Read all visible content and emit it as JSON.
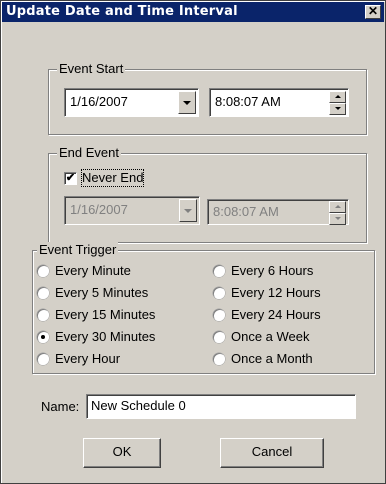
{
  "window": {
    "title": "Update Date and Time Interval",
    "close_glyph": "✕"
  },
  "event_start": {
    "label": "Event Start",
    "date": "1/16/2007",
    "time": "8:08:07 AM"
  },
  "end_event": {
    "label": "End Event",
    "never_end_label": "Never End",
    "never_end_checked": true,
    "date": "1/16/2007",
    "time": "8:08:07 AM"
  },
  "event_trigger": {
    "label": "Event Trigger",
    "options": [
      {
        "label": "Every Minute",
        "selected": false
      },
      {
        "label": "Every 5 Minutes",
        "selected": false
      },
      {
        "label": "Every 15 Minutes",
        "selected": false
      },
      {
        "label": "Every 30 Minutes",
        "selected": true
      },
      {
        "label": "Every Hour",
        "selected": false
      },
      {
        "label": "Every 6 Hours",
        "selected": false
      },
      {
        "label": "Every 12 Hours",
        "selected": false
      },
      {
        "label": "Every 24 Hours",
        "selected": false
      },
      {
        "label": "Once a Week",
        "selected": false
      },
      {
        "label": "Once a Month",
        "selected": false
      }
    ]
  },
  "name": {
    "label": "Name:",
    "value": "New Schedule 0"
  },
  "buttons": {
    "ok": "OK",
    "cancel": "Cancel"
  },
  "colors": {
    "titlebar": "#0a246a",
    "face": "#d4d0c8"
  }
}
